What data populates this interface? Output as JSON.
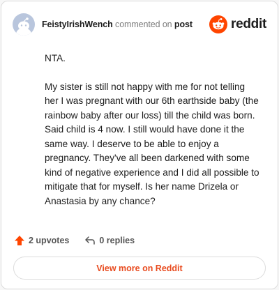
{
  "header": {
    "username": "FeistyIrishWench",
    "action_text": " commented on ",
    "post_link": "post",
    "logo_text": "reddit"
  },
  "comment": {
    "paragraphs": [
      "NTA.",
      "My sister is still not happy with me for not telling her I was pregnant with our 6th earthside baby (the rainbow baby after our loss) till the child was born. Said child is 4 now. I still would have done it the same way. I deserve to be able to enjoy a pregnancy. They've all been darkened with some kind of negative experience and I did all possible to mitigate that for myself. Is her name Drizela or Anastasia by any chance?"
    ]
  },
  "actions": {
    "upvotes": "2 upvotes",
    "replies": "0 replies"
  },
  "footer": {
    "view_more": "View more on Reddit"
  },
  "colors": {
    "brand": "#ff4500",
    "upvote": "#ff4500",
    "link": "#e84b1f",
    "avatar_bg": "#b9c6dd"
  },
  "icons": {
    "avatar": "snoo-avatar",
    "logo": "reddit-logo-icon",
    "upvote": "upvote-arrow-icon",
    "reply": "reply-arrow-icon"
  }
}
